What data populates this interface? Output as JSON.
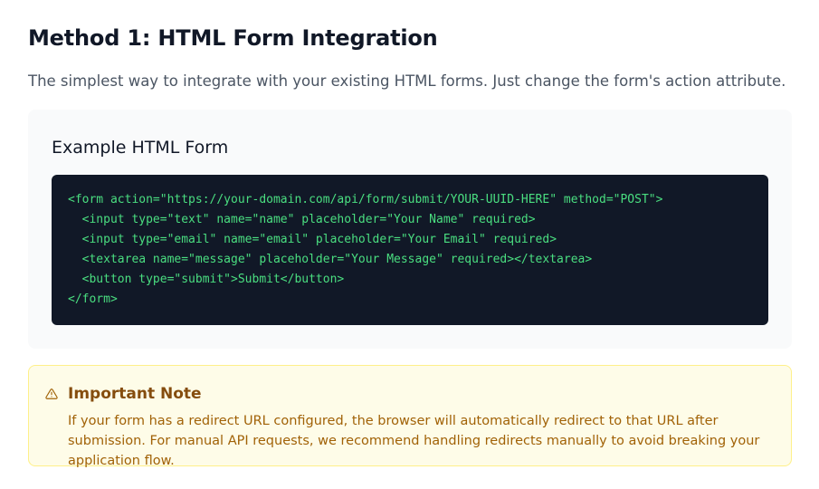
{
  "header": {
    "title": "Method 1: HTML Form Integration",
    "subtitle": "The simplest way to integrate with your existing HTML forms. Just change the form's action attribute."
  },
  "example": {
    "title": "Example HTML Form",
    "code_lines": [
      "<form action=\"https://your-domain.com/api/form/submit/YOUR-UUID-HERE\" method=\"POST\">",
      "  <input type=\"text\" name=\"name\" placeholder=\"Your Name\" required>",
      "  <input type=\"email\" name=\"email\" placeholder=\"Your Email\" required>",
      "  <textarea name=\"message\" placeholder=\"Your Message\" required></textarea>",
      "  <button type=\"submit\">Submit</button>",
      "</form>"
    ]
  },
  "note": {
    "icon": "warning-icon",
    "title": "Important Note",
    "text": "If your form has a redirect URL configured, the browser will automatically redirect to that URL after submission. For manual API requests, we recommend handling redirects manually to avoid breaking your application flow."
  },
  "colors": {
    "code_bg": "#111827",
    "code_text": "#4ade80",
    "card_bg": "#f9fafb",
    "note_bg": "#fefce8",
    "note_border": "#fef08a",
    "note_title": "#854d0e",
    "note_text": "#a16207"
  }
}
